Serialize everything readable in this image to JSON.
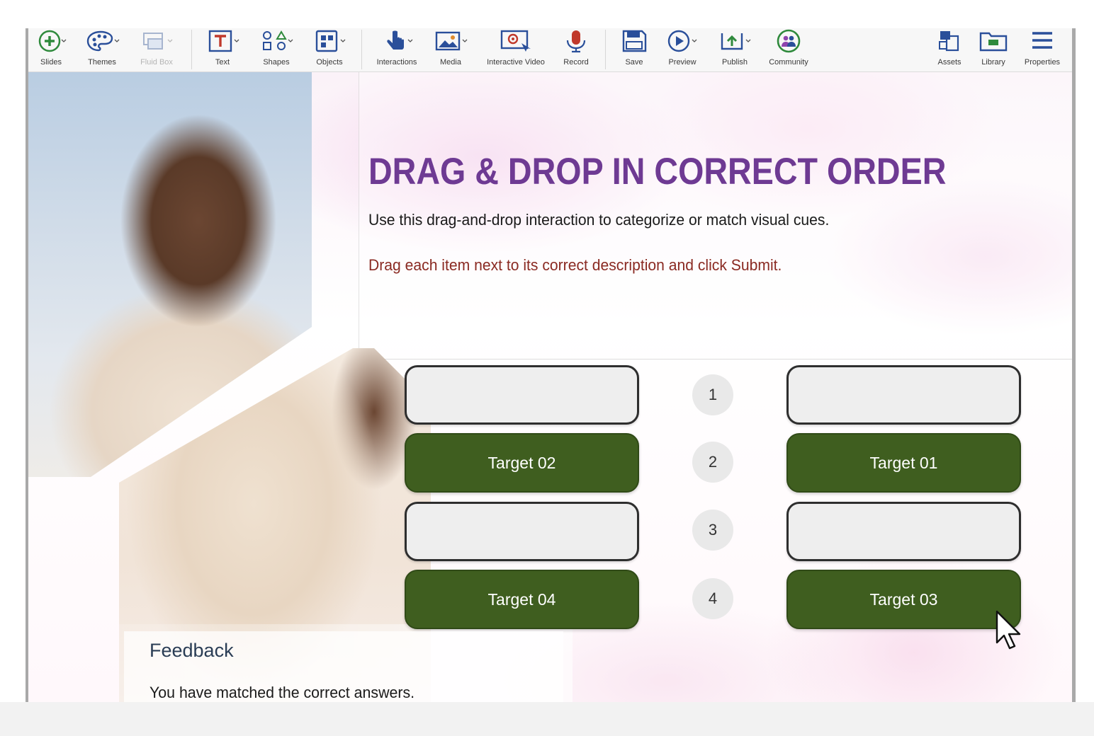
{
  "toolbar": {
    "items": [
      {
        "label": "Slides",
        "icon": "plus-circle-icon"
      },
      {
        "label": "Themes",
        "icon": "palette-icon"
      },
      {
        "label": "Fluid Box",
        "icon": "fluid-box-icon"
      },
      {
        "label": "Text",
        "icon": "text-icon"
      },
      {
        "label": "Shapes",
        "icon": "shapes-icon"
      },
      {
        "label": "Objects",
        "icon": "objects-icon"
      },
      {
        "label": "Interactions",
        "icon": "hand-pointer-icon"
      },
      {
        "label": "Media",
        "icon": "image-icon"
      },
      {
        "label": "Interactive Video",
        "icon": "interactive-video-icon"
      },
      {
        "label": "Record",
        "icon": "microphone-icon"
      },
      {
        "label": "Save",
        "icon": "floppy-disk-icon"
      },
      {
        "label": "Preview",
        "icon": "play-circle-icon"
      },
      {
        "label": "Publish",
        "icon": "publish-icon"
      },
      {
        "label": "Community",
        "icon": "community-icon"
      },
      {
        "label": "Assets",
        "icon": "assets-icon"
      },
      {
        "label": "Library",
        "icon": "library-icon"
      },
      {
        "label": "Properties",
        "icon": "hamburger-menu-icon"
      }
    ]
  },
  "slide": {
    "title": "DRAG & DROP IN CORRECT ORDER",
    "subtitle": "Use this drag-and-drop interaction to categorize or match visual cues.",
    "instruction": "Drag each item next to its correct description and click Submit.",
    "rows": [
      {
        "number": "1",
        "left": "",
        "right": ""
      },
      {
        "number": "2",
        "left": "Target 02",
        "right": "Target 01"
      },
      {
        "number": "3",
        "left": "",
        "right": ""
      },
      {
        "number": "4",
        "left": "Target 04",
        "right": "Target 03"
      }
    ],
    "feedback": {
      "title": "Feedback",
      "text": "You have matched the correct answers."
    }
  },
  "colors": {
    "title": "#6e3a93",
    "instruction": "#8a2a22",
    "target_fill": "#3f5e1f",
    "slot_fill": "#eeeeee",
    "toolbar_bg": "#f7f7f7"
  }
}
